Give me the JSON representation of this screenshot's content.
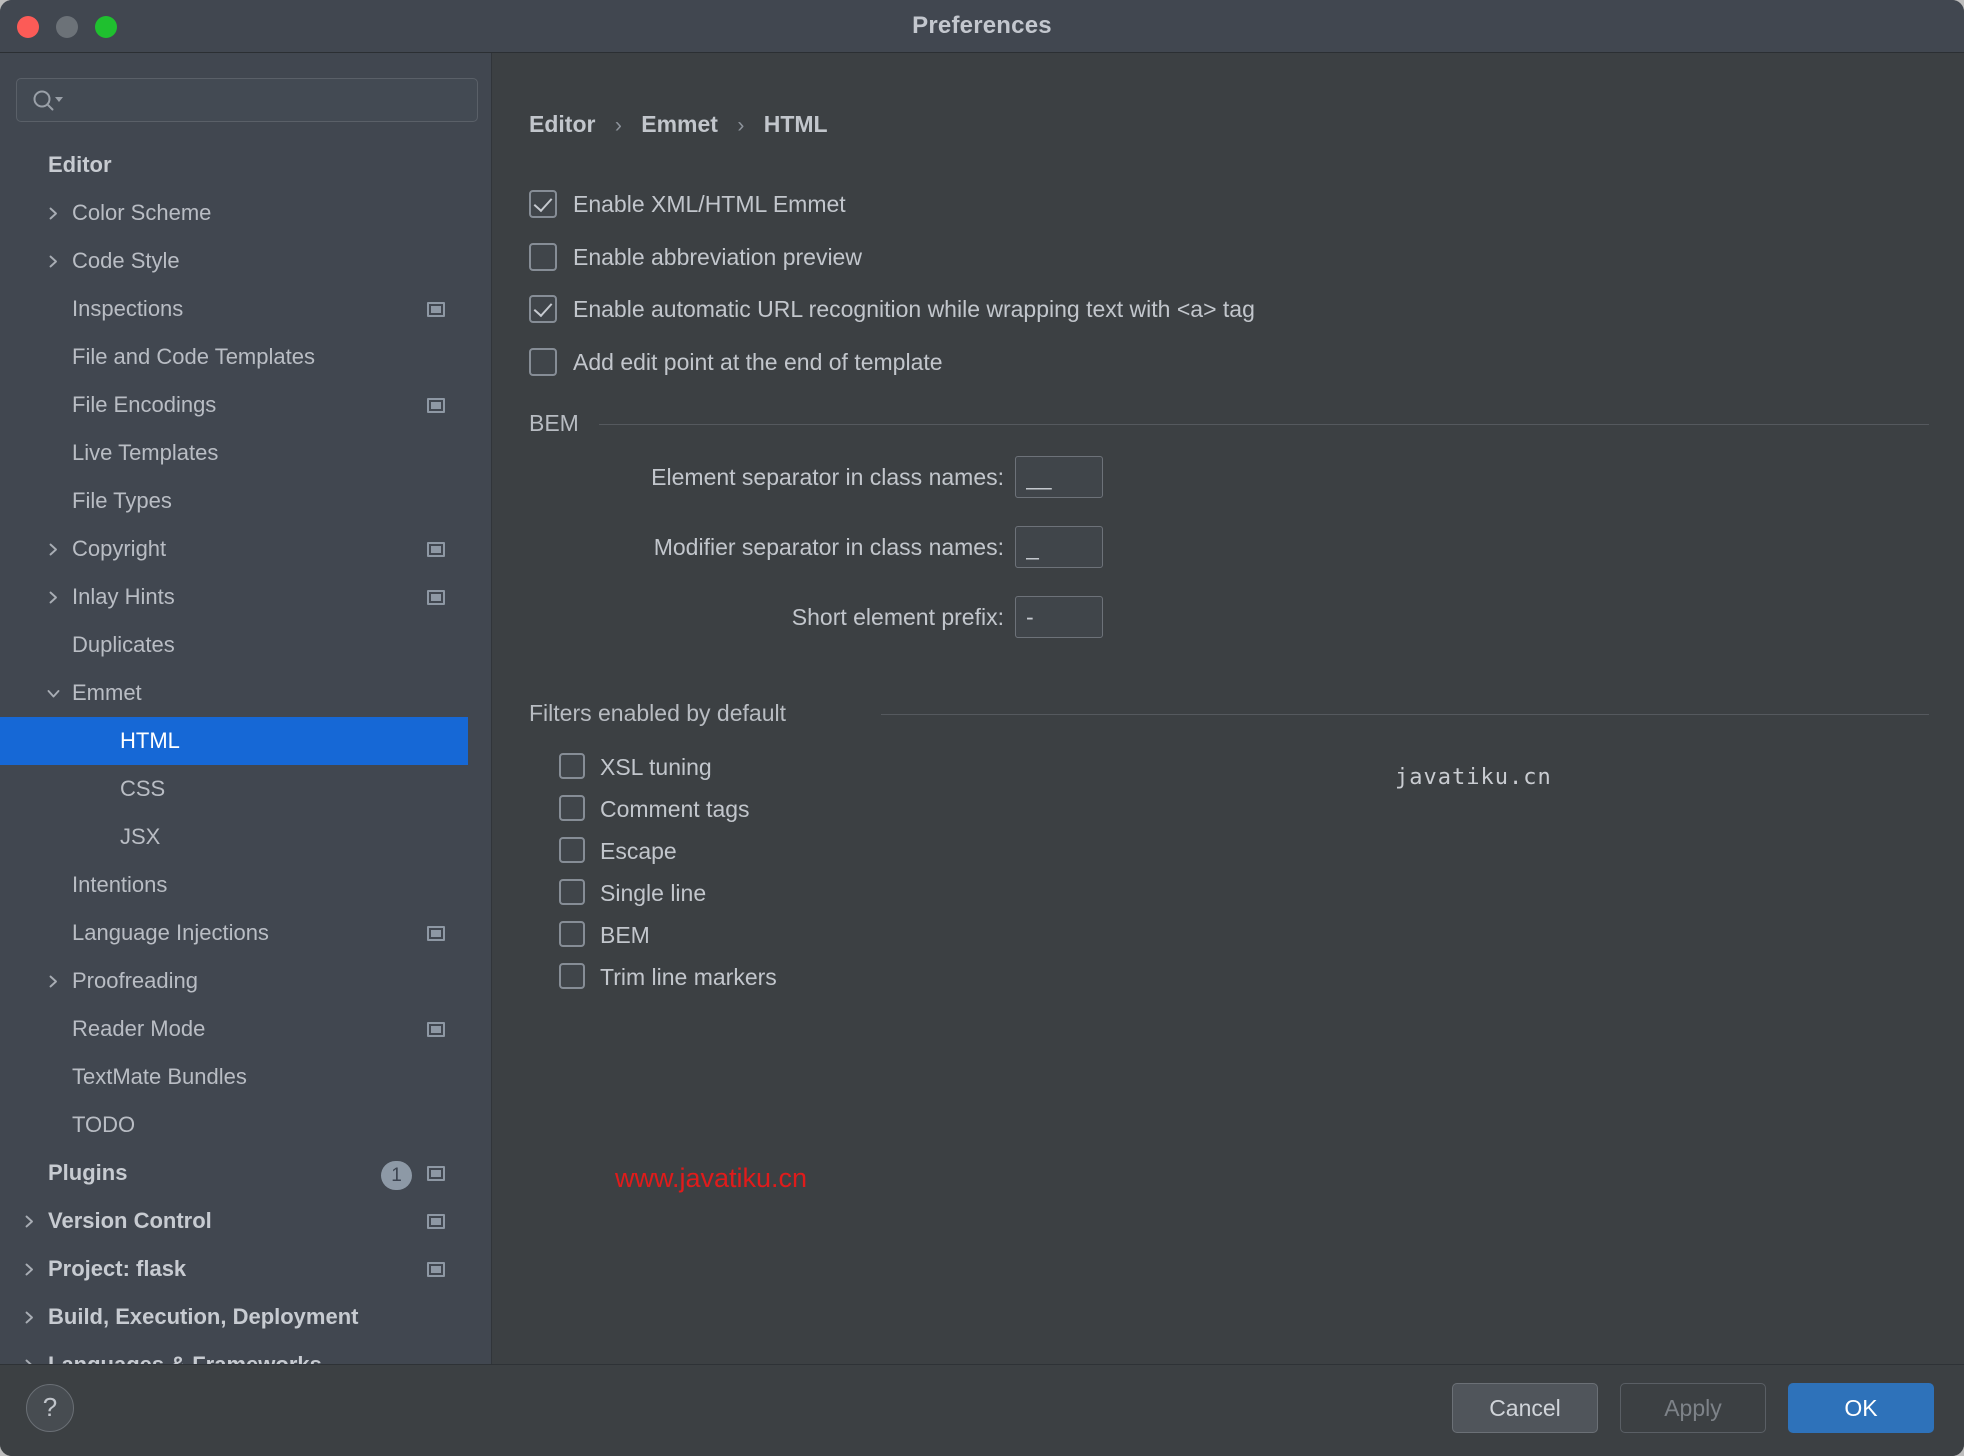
{
  "window": {
    "title": "Preferences",
    "traffic_lights": [
      "close",
      "minimize",
      "maximize"
    ],
    "accent_color": "#1668d6",
    "selection_color": "#1668d6",
    "primary_button_color": "#2e72ba"
  },
  "sidebar": {
    "search": {
      "value": "",
      "placeholder": "",
      "icon": "search-icon"
    },
    "items": [
      {
        "label": "Editor",
        "indent": 48,
        "bold": true,
        "arrow": "none",
        "scope": false,
        "selected": false,
        "badge": null
      },
      {
        "label": "Color Scheme",
        "indent": 72,
        "bold": false,
        "arrow": "right",
        "scope": false,
        "selected": false,
        "badge": null
      },
      {
        "label": "Code Style",
        "indent": 72,
        "bold": false,
        "arrow": "right",
        "scope": false,
        "selected": false,
        "badge": null
      },
      {
        "label": "Inspections",
        "indent": 72,
        "bold": false,
        "arrow": "none",
        "scope": true,
        "selected": false,
        "badge": null
      },
      {
        "label": "File and Code Templates",
        "indent": 72,
        "bold": false,
        "arrow": "none",
        "scope": false,
        "selected": false,
        "badge": null
      },
      {
        "label": "File Encodings",
        "indent": 72,
        "bold": false,
        "arrow": "none",
        "scope": true,
        "selected": false,
        "badge": null
      },
      {
        "label": "Live Templates",
        "indent": 72,
        "bold": false,
        "arrow": "none",
        "scope": false,
        "selected": false,
        "badge": null
      },
      {
        "label": "File Types",
        "indent": 72,
        "bold": false,
        "arrow": "none",
        "scope": false,
        "selected": false,
        "badge": null
      },
      {
        "label": "Copyright",
        "indent": 72,
        "bold": false,
        "arrow": "right",
        "scope": true,
        "selected": false,
        "badge": null
      },
      {
        "label": "Inlay Hints",
        "indent": 72,
        "bold": false,
        "arrow": "right",
        "scope": true,
        "selected": false,
        "badge": null
      },
      {
        "label": "Duplicates",
        "indent": 72,
        "bold": false,
        "arrow": "none",
        "scope": false,
        "selected": false,
        "badge": null
      },
      {
        "label": "Emmet",
        "indent": 72,
        "bold": false,
        "arrow": "down",
        "scope": false,
        "selected": false,
        "badge": null
      },
      {
        "label": "HTML",
        "indent": 120,
        "bold": false,
        "arrow": "none",
        "scope": false,
        "selected": true,
        "badge": null
      },
      {
        "label": "CSS",
        "indent": 120,
        "bold": false,
        "arrow": "none",
        "scope": false,
        "selected": false,
        "badge": null
      },
      {
        "label": "JSX",
        "indent": 120,
        "bold": false,
        "arrow": "none",
        "scope": false,
        "selected": false,
        "badge": null
      },
      {
        "label": "Intentions",
        "indent": 72,
        "bold": false,
        "arrow": "none",
        "scope": false,
        "selected": false,
        "badge": null
      },
      {
        "label": "Language Injections",
        "indent": 72,
        "bold": false,
        "arrow": "none",
        "scope": true,
        "selected": false,
        "badge": null
      },
      {
        "label": "Proofreading",
        "indent": 72,
        "bold": false,
        "arrow": "right",
        "scope": false,
        "selected": false,
        "badge": null
      },
      {
        "label": "Reader Mode",
        "indent": 72,
        "bold": false,
        "arrow": "none",
        "scope": true,
        "selected": false,
        "badge": null
      },
      {
        "label": "TextMate Bundles",
        "indent": 72,
        "bold": false,
        "arrow": "none",
        "scope": false,
        "selected": false,
        "badge": null
      },
      {
        "label": "TODO",
        "indent": 72,
        "bold": false,
        "arrow": "none",
        "scope": false,
        "selected": false,
        "badge": null
      },
      {
        "label": "Plugins",
        "indent": 48,
        "bold": true,
        "arrow": "none",
        "scope": true,
        "selected": false,
        "badge": "1"
      },
      {
        "label": "Version Control",
        "indent": 48,
        "bold": true,
        "arrow": "right",
        "scope": true,
        "selected": false,
        "badge": null
      },
      {
        "label": "Project: flask",
        "indent": 48,
        "bold": true,
        "arrow": "right",
        "scope": true,
        "selected": false,
        "badge": null
      },
      {
        "label": "Build, Execution, Deployment",
        "indent": 48,
        "bold": true,
        "arrow": "right",
        "scope": false,
        "selected": false,
        "badge": null
      },
      {
        "label": "Languages & Frameworks",
        "indent": 48,
        "bold": true,
        "arrow": "right",
        "scope": false,
        "selected": false,
        "badge": null
      }
    ]
  },
  "content": {
    "breadcrumb": {
      "root": "Editor",
      "mid": "Emmet",
      "leaf": "HTML",
      "separator": "›"
    },
    "top_checkboxes": [
      {
        "label": "Enable XML/HTML Emmet",
        "checked": true
      },
      {
        "label": "Enable abbreviation preview",
        "checked": false
      },
      {
        "label": "Enable automatic URL recognition while wrapping text with <a> tag",
        "checked": true
      },
      {
        "label": "Add edit point at the end of template",
        "checked": false
      }
    ],
    "bem": {
      "title": "BEM",
      "fields": [
        {
          "label": "Element separator in class names:",
          "value": "__"
        },
        {
          "label": "Modifier separator in class names:",
          "value": "_"
        },
        {
          "label": "Short element prefix:",
          "value": "-"
        }
      ]
    },
    "filters": {
      "title": "Filters enabled by default",
      "items": [
        {
          "label": "XSL tuning",
          "checked": false
        },
        {
          "label": "Comment tags",
          "checked": false
        },
        {
          "label": "Escape",
          "checked": false
        },
        {
          "label": "Single line",
          "checked": false
        },
        {
          "label": "BEM",
          "checked": false
        },
        {
          "label": "Trim line markers",
          "checked": false
        }
      ]
    },
    "watermark_mono": "javatiku.cn",
    "watermark_red": "www.javatiku.cn",
    "watermark_red_color": "#e01b1b"
  },
  "footer": {
    "help_label": "?",
    "cancel_label": "Cancel",
    "apply_label": "Apply",
    "ok_label": "OK",
    "apply_enabled": false
  }
}
